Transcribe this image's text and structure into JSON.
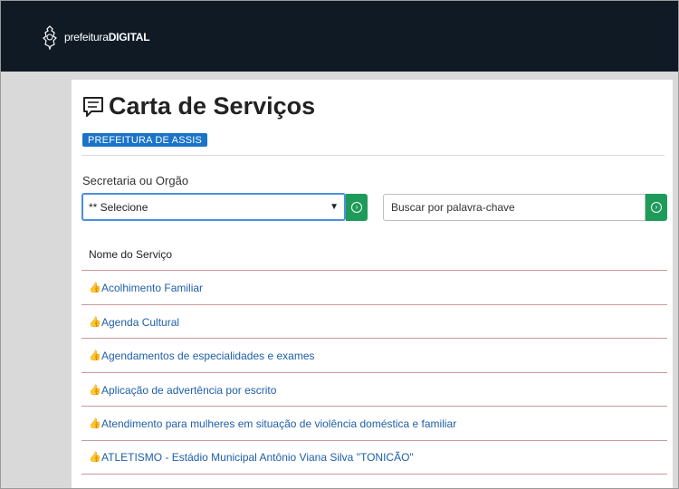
{
  "header": {
    "brand_light": "prefeitura",
    "brand_bold": "DIGITAL",
    "logo_icon": "coat-of-arms-icon"
  },
  "page": {
    "title": "Carta de Serviços",
    "title_icon": "speech-bubble-icon",
    "badge": "PREFEITURA DE ASSIS"
  },
  "filters": {
    "secretaria_label": "Secretaria ou Orgão",
    "select_value": "** Selecione",
    "search_placeholder": "Buscar por palavra-chave",
    "go_icon": "circle-chevron-right-icon"
  },
  "services": {
    "column_header": "Nome do Serviço",
    "item_icon": "thumbs-up-icon",
    "items": [
      "Acolhimento Familiar",
      "Agenda Cultural",
      "Agendamentos de especialidades e exames",
      "Aplicação de advertência por escrito",
      "Atendimento para mulheres em situação de violência doméstica e familiar",
      "ATLETISMO - Estádio Municipal Antônio Viana Silva \"TONICÃO\""
    ]
  },
  "colors": {
    "topbar": "#0f1a25",
    "badge": "#1a73c9",
    "go_button": "#1e9b5a",
    "link": "#1f5fa8",
    "row_divider": "#c99a9a"
  }
}
